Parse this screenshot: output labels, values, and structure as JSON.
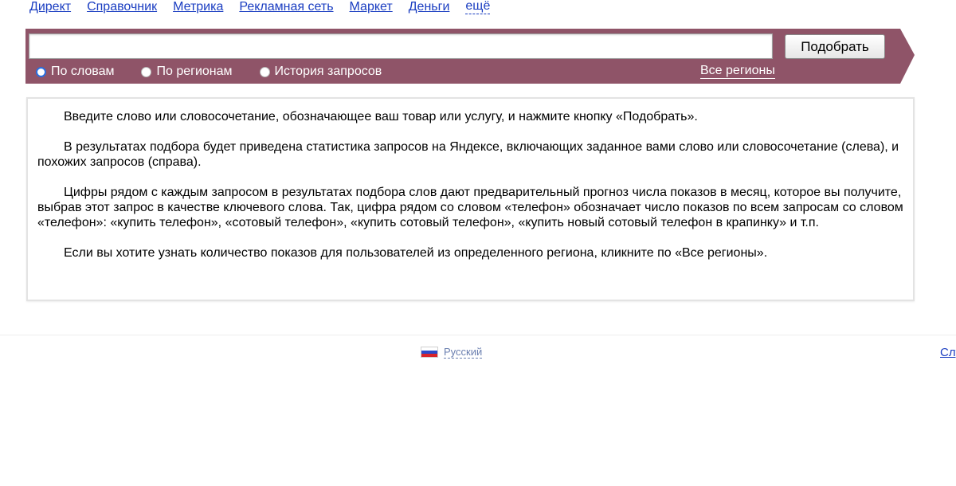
{
  "topnav": {
    "items": [
      "Директ",
      "Справочник",
      "Метрика",
      "Рекламная сеть",
      "Маркет",
      "Деньги"
    ],
    "more_label": "ещё"
  },
  "search": {
    "value": "",
    "placeholder": "",
    "submit_label": "Подобрать",
    "modes": [
      {
        "label": "По словам",
        "selected": true
      },
      {
        "label": "По регионам",
        "selected": false
      },
      {
        "label": "История запросов",
        "selected": false
      }
    ],
    "regions_link": "Все регионы"
  },
  "info": {
    "paragraphs": [
      "Введите слово или словосочетание, обозначающее ваш товар или услугу, и нажмите кнопку «Подобрать».",
      "В результатах подбора будет приведена статистика запросов на Яндексе, включающих заданное вами слово или словосочетание (слева), и похожих запросов (справа).",
      "Цифры рядом с каждым запросом в результатах подбора слов дают предварительный прогноз числа показов в месяц, которое вы получите, выбрав этот запрос в качестве ключевого слова. Так, цифра рядом со словом «телефон» обозначает число показов по всем запросам со словом «телефон»: «купить телефон», «сотовый телефон», «купить сотовый телефон», «купить новый сотовый телефон в крапинку» и т.п.",
      "Если вы хотите узнать количество показов для пользователей из определенного региона, кликните по «Все регионы»."
    ]
  },
  "footer": {
    "language": "Русский",
    "service_link": "Служба поддержки"
  },
  "colors": {
    "bar": "#8f5468",
    "link": "#1a3dc1",
    "radio_selected": "#2a6fe0"
  }
}
